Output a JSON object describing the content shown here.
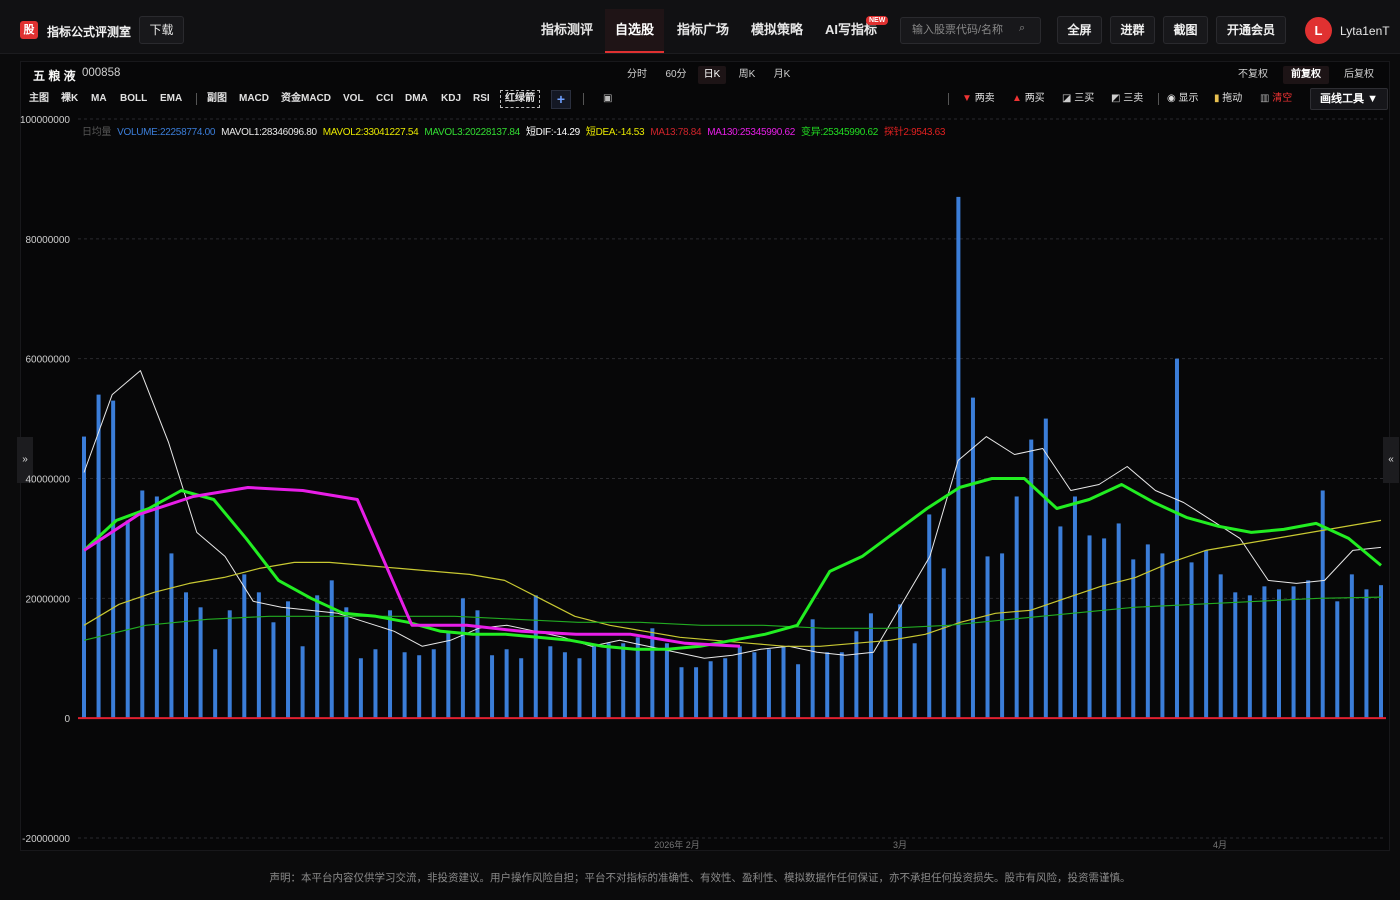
{
  "app": {
    "logo_char": "股",
    "brand": "指标公式评测室",
    "download_label": "下载",
    "nav": [
      "指标测评",
      "自选股",
      "指标广场",
      "模拟策略",
      "AI写指标"
    ],
    "new_badge": "NEW",
    "search_placeholder": "输入股票代码/名称",
    "buttons": [
      "全屏",
      "进群",
      "截图",
      "开通会员"
    ],
    "avatar_letter": "L",
    "username": "Lyta1enT"
  },
  "stock": {
    "name": "五 粮 液",
    "code": "000858"
  },
  "periods": [
    "分时",
    "60分",
    "日K",
    "周K",
    "月K"
  ],
  "adjust": [
    "不复权",
    "前复权",
    "后复权"
  ],
  "indicators": [
    "主图",
    "裸K",
    "MA",
    "BOLL",
    "EMA",
    "副图",
    "MACD",
    "资金MACD",
    "VOL",
    "CCI",
    "DMA",
    "KDJ",
    "RSI",
    "红绿箭"
  ],
  "tools": {
    "two_sell": "两卖",
    "two_buy": "两买",
    "three_buy": "三买",
    "three_sell": "三卖",
    "show": "显示",
    "drag": "拖动",
    "clear": "清空",
    "draw_tools": "画线工具 ▼"
  },
  "legend": [
    {
      "text": "日均量",
      "color": "#555555"
    },
    {
      "text": "VOLUME:22258774.00",
      "color": "#3b7dd8"
    },
    {
      "text": "MAVOL1:28346096.80",
      "color": "#e8e8e8"
    },
    {
      "text": "MAVOL2:33041227.54",
      "color": "#e8e800"
    },
    {
      "text": "MAVOL3:20228137.84",
      "color": "#33dd33"
    },
    {
      "text": "短DIF:-14.29",
      "color": "#ffffff"
    },
    {
      "text": "短DEA:-14.53",
      "color": "#e8e800"
    },
    {
      "text": "MA13:78.84",
      "color": "#d0242b"
    },
    {
      "text": "MA130:25345990.62",
      "color": "#e81ee8"
    },
    {
      "text": "变异:25345990.62",
      "color": "#22dd22"
    },
    {
      "text": "探针2:9543.63",
      "color": "#e02020"
    }
  ],
  "side_tabs": {
    "left": "»",
    "right": "«"
  },
  "footer": "声明：本平台内容仅供学习交流，非投资建议。用户操作风险自担；平台不对指标的准确性、有效性、盈利性、模拟数据作任何保证，亦不承担任何投资损失。股市有风险，投资需谨慎。",
  "chart_data": {
    "type": "bar",
    "title": "",
    "ylabel": "",
    "ylim": [
      -20000000,
      100000000
    ],
    "yticks": [
      "100000000",
      "80000000",
      "60000000",
      "40000000",
      "20000000",
      "0",
      "-20000000"
    ],
    "xtick_labels": [
      "2026年 2月",
      "3月",
      "4月"
    ],
    "series": [
      {
        "name": "VOLUME",
        "color": "#3b7dd8",
        "values": [
          47000000,
          54000000,
          53000000,
          33000000,
          38000000,
          37000000,
          27500000,
          21000000,
          18500000,
          11500000,
          18000000,
          24000000,
          21000000,
          16000000,
          19500000,
          12000000,
          20500000,
          23000000,
          18500000,
          10000000,
          11500000,
          18000000,
          11000000,
          10500000,
          11500000,
          14500000,
          20000000,
          18000000,
          10500000,
          11500000,
          10000000,
          20500000,
          12000000,
          11000000,
          10000000,
          12000000,
          12500000,
          12500000,
          13500000,
          15000000,
          12500000,
          8500000,
          8500000,
          9500000,
          10000000,
          12000000,
          11000000,
          11500000,
          12000000,
          9000000,
          16500000,
          11000000,
          11000000,
          14500000,
          17500000,
          13000000,
          19000000,
          12500000,
          34000000,
          25000000,
          87000000,
          53500000,
          27000000,
          27500000,
          37000000,
          46500000,
          50000000,
          32000000,
          37000000,
          30500000,
          30000000,
          32500000,
          26500000,
          29000000,
          27500000,
          60000000,
          26000000,
          28000000,
          24000000,
          21000000,
          20500000,
          22000000,
          21500000,
          22000000,
          23000000,
          38000000,
          19500000,
          24000000,
          21500000,
          22200000
        ]
      },
      {
        "name": "MAVOL1",
        "color": "#e8e8e8",
        "values": [
          41000000,
          54000000,
          58000000,
          46000000,
          31000000,
          27000000,
          19500000,
          18500000,
          18000000,
          17500000,
          16000000,
          14500000,
          12000000,
          13000000,
          15000000,
          15500000,
          14500000,
          13500000,
          12000000,
          13000000,
          12000000,
          11000000,
          10000000,
          10500000,
          11500000,
          12000000,
          11000000,
          10500000,
          11000000,
          19000000,
          27000000,
          43000000,
          47000000,
          44000000,
          45000000,
          38000000,
          39000000,
          42000000,
          38000000,
          36000000,
          33000000,
          30000000,
          23000000,
          22500000,
          23000000,
          28000000,
          28500000
        ]
      },
      {
        "name": "MAVOL2",
        "color": "#c8c832",
        "values": [
          15500000,
          19000000,
          21000000,
          22500000,
          23500000,
          25000000,
          26000000,
          26000000,
          25500000,
          25000000,
          24500000,
          24000000,
          23000000,
          20000000,
          17000000,
          15500000,
          14500000,
          13500000,
          13000000,
          12500000,
          12000000,
          12000000,
          12500000,
          13000000,
          14000000,
          16000000,
          17500000,
          18000000,
          20000000,
          22000000,
          23500000,
          26000000,
          28000000,
          29000000,
          30000000,
          31000000,
          32000000,
          33000000
        ]
      },
      {
        "name": "MAVOL3",
        "color": "#22aa22",
        "values": [
          13000000,
          15500000,
          16500000,
          17000000,
          17000000,
          17000000,
          17000000,
          16500000,
          16000000,
          16000000,
          15500000,
          15500000,
          15000000,
          15000000,
          15500000,
          16500000,
          17500000,
          18500000,
          19000000,
          19500000,
          20000000,
          20200000
        ]
      },
      {
        "name": "变异",
        "color": "#22ee22",
        "values": [
          28000000,
          33000000,
          35000000,
          38000000,
          36500000,
          30000000,
          23000000,
          20000000,
          17500000,
          17000000,
          16000000,
          14500000,
          14000000,
          14000000,
          13500000,
          13000000,
          12000000,
          11500000,
          11500000,
          12000000,
          13000000,
          14000000,
          15500000,
          24500000,
          27000000,
          31000000,
          35000000,
          38500000,
          40000000,
          40000000,
          35000000,
          36500000,
          39000000,
          36000000,
          33500000,
          32000000,
          31000000,
          31500000,
          32500000,
          30000000,
          25500000
        ]
      },
      {
        "name": "MA130",
        "color": "#e81ee8",
        "values": [
          28000000,
          34000000,
          37000000,
          38500000,
          38000000,
          36500000,
          15500000,
          15500000,
          14500000,
          14000000,
          14000000,
          12500000,
          12000000
        ]
      }
    ]
  }
}
